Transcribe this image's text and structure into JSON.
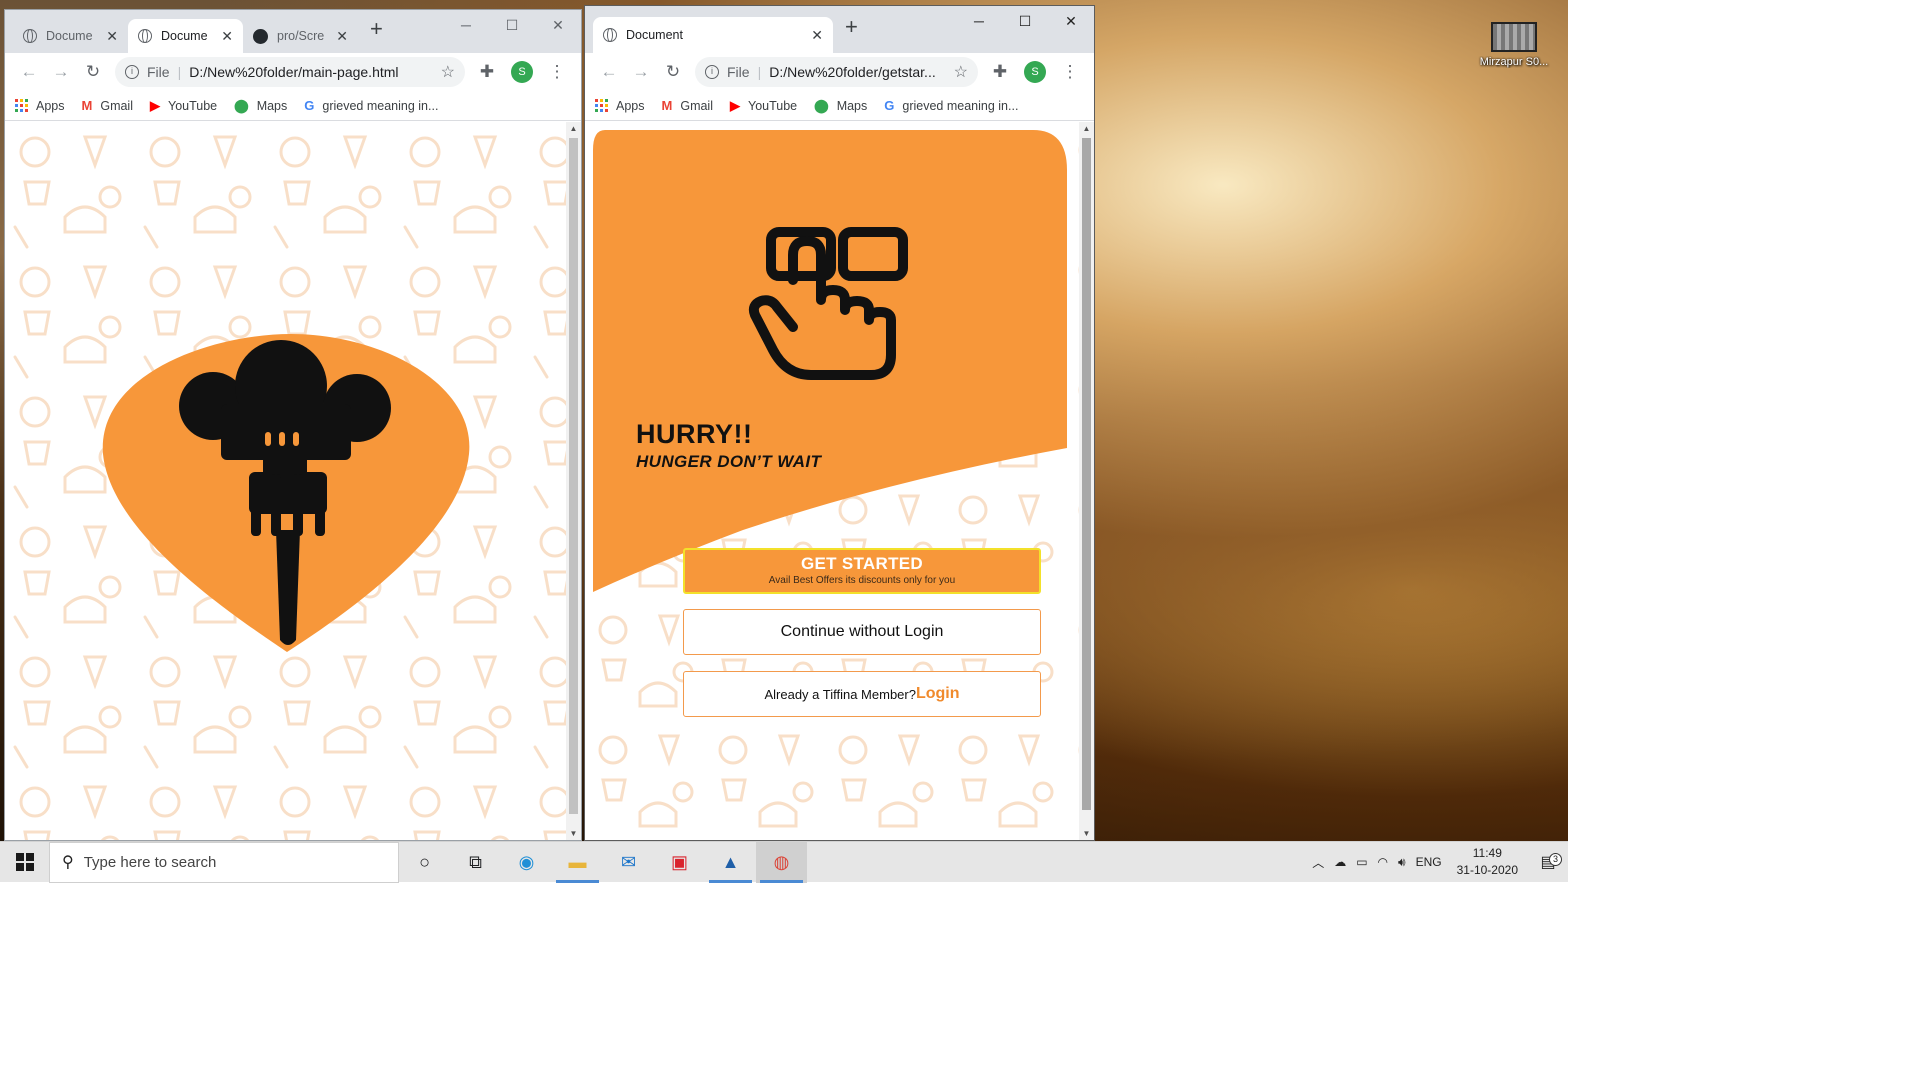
{
  "desktop": {
    "icon_label": "Mirzapur S0..."
  },
  "window1": {
    "tabs": [
      {
        "title": "Docume",
        "icon": "globe-icon"
      },
      {
        "title": "Docume",
        "icon": "globe-icon"
      },
      {
        "title": "pro/Scre",
        "icon": "github-icon"
      }
    ],
    "url_scheme": "File",
    "url": "D:/New%20folder/main-page.html"
  },
  "window2": {
    "tabs": [
      {
        "title": "Document",
        "icon": "globe-icon"
      }
    ],
    "url_scheme": "File",
    "url": "D:/New%20folder/getstar..."
  },
  "bookmarks": [
    "Apps",
    "Gmail",
    "YouTube",
    "Maps",
    "grieved meaning in..."
  ],
  "profile_initial": "S",
  "page2": {
    "headline": "HURRY!!",
    "tagline": "HUNGER DON’T WAIT",
    "get_started": "GET STARTED",
    "get_started_sub": "Avail Best Offers its discounts only for you",
    "continue_label": "Continue without Login",
    "member_text": "Already a Tiffina Member?",
    "login_link": "Login"
  },
  "taskbar": {
    "search_placeholder": "Type here to search",
    "language": "ENG",
    "time": "11:49",
    "date": "31-10-2020",
    "notification_count": "3"
  },
  "colors": {
    "brand_orange": "#f7973a",
    "button_border": "#f3e12a",
    "link_orange": "#f08a2c"
  }
}
